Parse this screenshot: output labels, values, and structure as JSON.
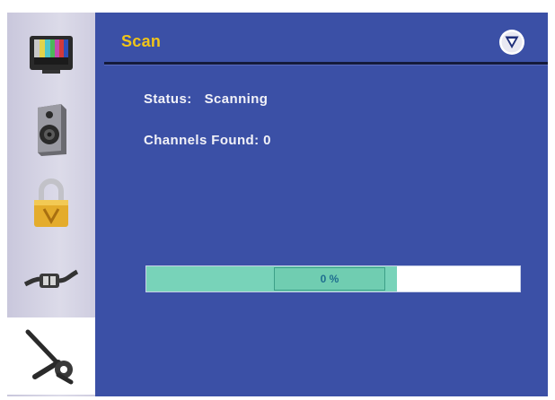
{
  "header": {
    "title": "Scan",
    "logo_icon": "v-logo-icon"
  },
  "sidebar": {
    "items": [
      {
        "icon": "tv-color-bars-icon",
        "selected": false
      },
      {
        "icon": "speaker-icon",
        "selected": false
      },
      {
        "icon": "padlock-icon",
        "selected": false
      },
      {
        "icon": "cable-connector-icon",
        "selected": false
      },
      {
        "icon": "wrench-tools-icon",
        "selected": true
      }
    ]
  },
  "status": {
    "label": "Status:",
    "value": "Scanning"
  },
  "channels": {
    "label": "Channels Found:",
    "value": "0"
  },
  "progress": {
    "label": "0 %",
    "fill_fraction": 0.67
  },
  "colors": {
    "background": "#3b50a6",
    "title": "#f0c419",
    "progress_fill": "#78d3b9"
  }
}
